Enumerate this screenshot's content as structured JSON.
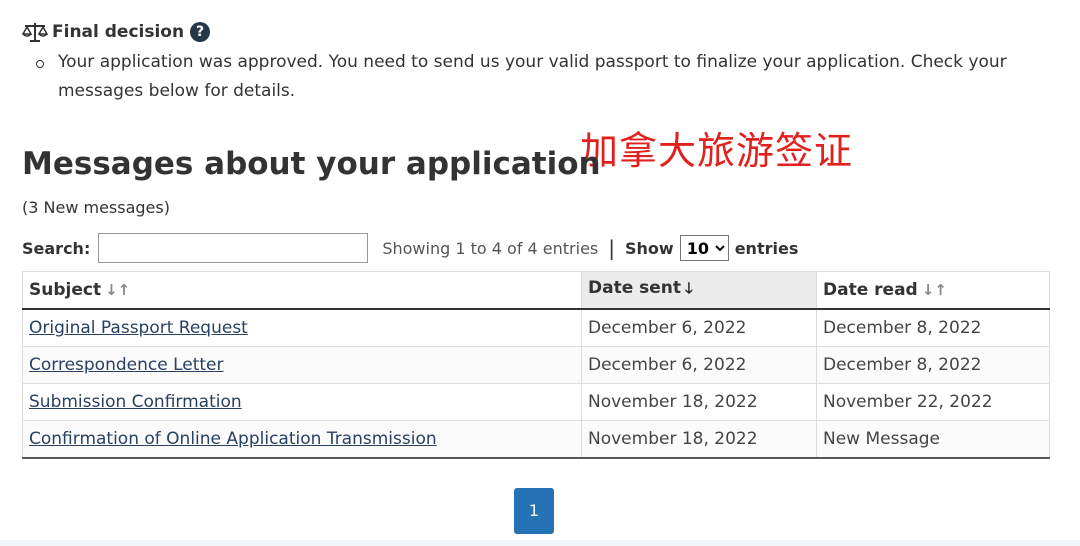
{
  "decision": {
    "label": "Final decision",
    "help_icon": "?",
    "items": [
      "Your application was approved. You need to send us your valid passport to finalize your application. Check your messages below for details."
    ]
  },
  "watermark": "加拿大旅游签证",
  "messages": {
    "title": "Messages about your application",
    "new_count": "(3 New messages)",
    "search_label": "Search:",
    "search_value": "",
    "showing": "Showing 1 to 4 of 4 entries",
    "separator": "|",
    "show_label": "Show",
    "page_size": "10",
    "entries_label": "entries",
    "columns": [
      {
        "label": "Subject",
        "sort_icon": "↓↑"
      },
      {
        "label": "Date sent",
        "sort_icon": "🡓"
      },
      {
        "label": "Date read",
        "sort_icon": "↓↑"
      }
    ],
    "rows": [
      {
        "subject": "Original Passport Request",
        "date_sent": "December 6, 2022",
        "date_read": "December 8, 2022"
      },
      {
        "subject": "Correspondence Letter",
        "date_sent": "December 6, 2022",
        "date_read": "December 8, 2022"
      },
      {
        "subject": "Submission Confirmation",
        "date_sent": "November 18, 2022",
        "date_read": "November 22, 2022"
      },
      {
        "subject": "Confirmation of Online Application Transmission",
        "date_sent": "November 18, 2022",
        "date_read": "New Message"
      }
    ],
    "pagination": {
      "current_page": "1"
    }
  },
  "colors": {
    "watermark": "#e0211d",
    "link": "#284162",
    "page_button": "#2572b4",
    "help_icon_bg": "#26374a"
  }
}
